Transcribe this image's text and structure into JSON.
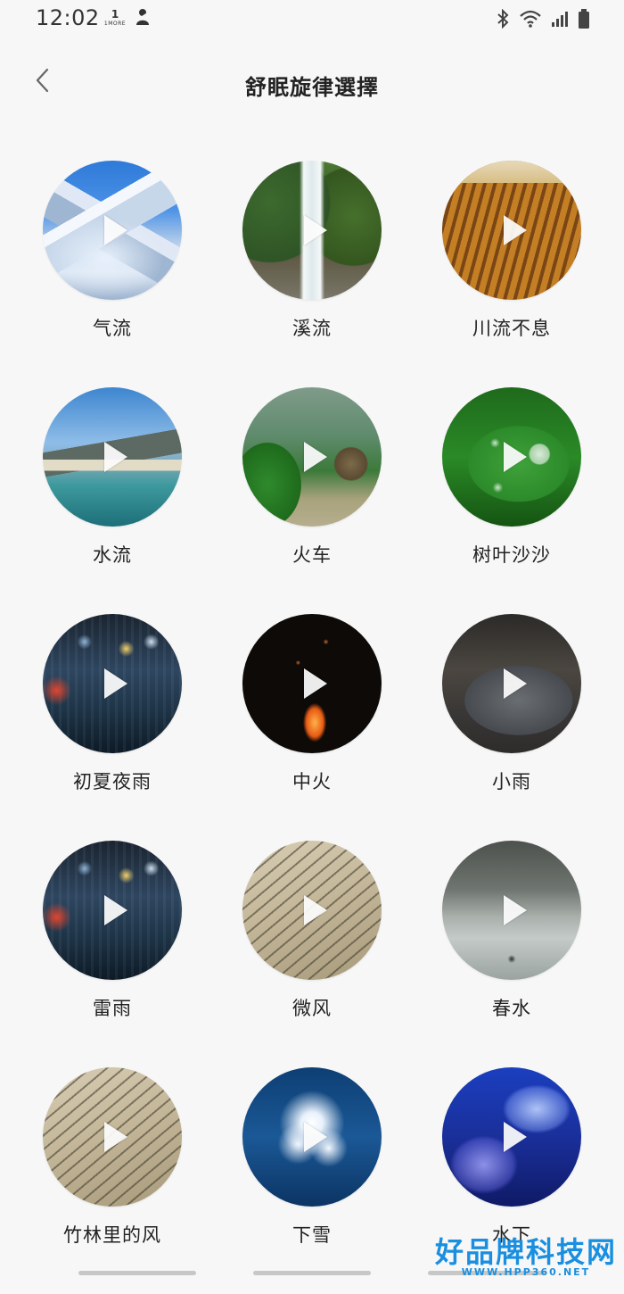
{
  "status_bar": {
    "time": "12:02",
    "brand_number": "1",
    "brand_text": "1MORE",
    "icons": [
      "notification-person-icon",
      "bluetooth-icon",
      "wifi-icon",
      "signal-icon",
      "battery-icon"
    ]
  },
  "header": {
    "title": "舒眠旋律選擇",
    "back_icon": "chevron-left-icon"
  },
  "melodies": [
    {
      "label": "气流",
      "thumb": "mountain-snow"
    },
    {
      "label": "溪流",
      "thumb": "waterfall"
    },
    {
      "label": "川流不息",
      "thumb": "farm-rows"
    },
    {
      "label": "水流",
      "thumb": "lake-river"
    },
    {
      "label": "火车",
      "thumb": "valley-house"
    },
    {
      "label": "树叶沙沙",
      "thumb": "leaf-drops"
    },
    {
      "label": "初夏夜雨",
      "thumb": "night-city-rain"
    },
    {
      "label": "中火",
      "thumb": "campfire"
    },
    {
      "label": "小雨",
      "thumb": "umbrella"
    },
    {
      "label": "雷雨",
      "thumb": "night-city-rain"
    },
    {
      "label": "微风",
      "thumb": "palm-leaf"
    },
    {
      "label": "春水",
      "thumb": "river-boat"
    },
    {
      "label": "竹林里的风",
      "thumb": "palm-leaf"
    },
    {
      "label": "下雪",
      "thumb": "snow-crystal"
    },
    {
      "label": "水下",
      "thumb": "jellyfish"
    }
  ],
  "watermark": {
    "text": "好品牌科技网",
    "url": "WWW.HPP360.NET"
  },
  "colors": {
    "background": "#f7f7f7",
    "title_text": "#222222",
    "watermark": "#1a8fe0"
  }
}
